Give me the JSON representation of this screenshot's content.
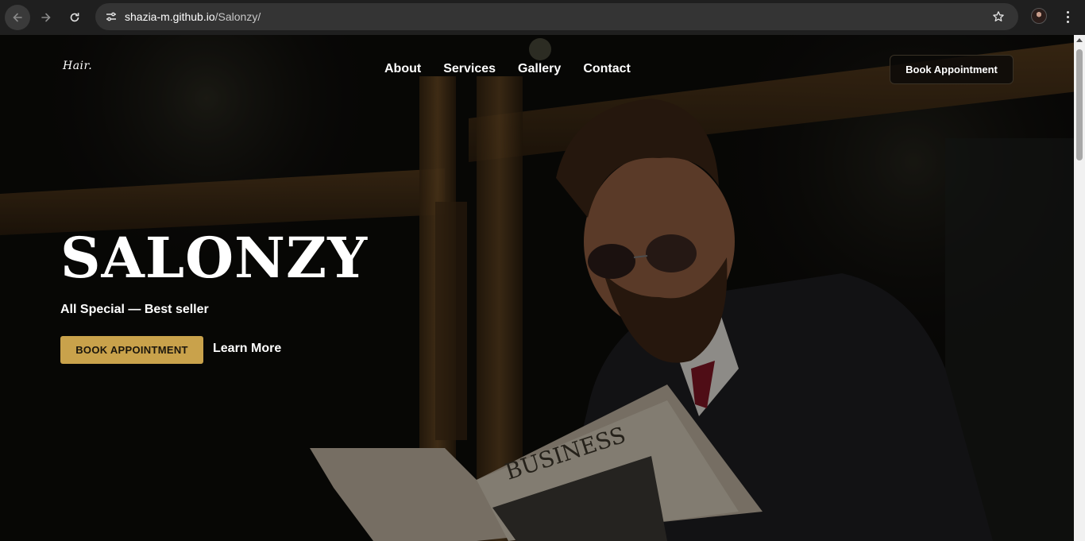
{
  "browser": {
    "url_host": "shazia-m.github.io",
    "url_path": "/Salonzy/",
    "icons": {
      "back": "arrow-left-icon",
      "forward": "arrow-right-icon",
      "reload": "reload-icon",
      "site_info": "tune-icon",
      "bookmark": "star-icon",
      "menu": "kebab-menu-icon"
    }
  },
  "site": {
    "logo": "Hair.",
    "nav": [
      {
        "label": "About"
      },
      {
        "label": "Services"
      },
      {
        "label": "Gallery"
      },
      {
        "label": "Contact"
      }
    ],
    "header_cta": "Book Appointment"
  },
  "hero": {
    "title": "SALONZY",
    "tagline": "All Special — Best seller",
    "primary_cta": "BOOK APPOINTMENT",
    "secondary_cta": "Learn More",
    "newspaper_word": "BUSINESS"
  },
  "colors": {
    "accent_gold": "#c9a24b",
    "chrome_bg": "#1f1f1f",
    "omnibox_bg": "#343434"
  }
}
